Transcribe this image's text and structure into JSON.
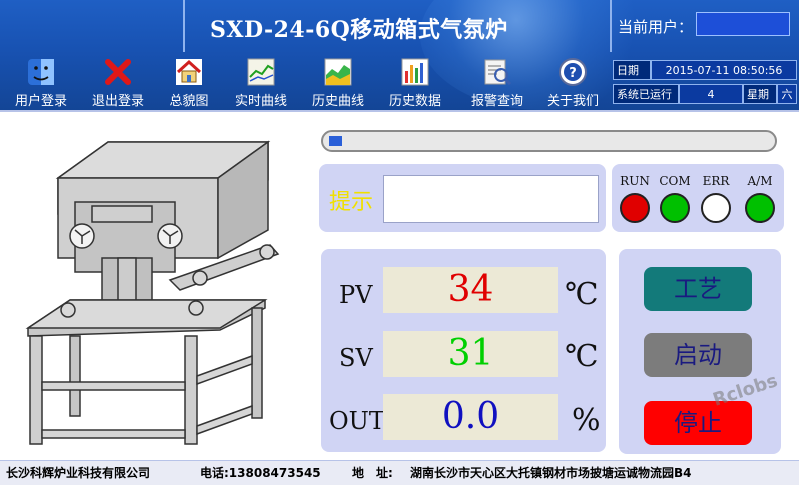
{
  "header": {
    "title": "SXD-24-6Q移动箱式气氛炉",
    "user_label": "当前用户：",
    "user_value": ""
  },
  "toolbar": [
    {
      "label": "用户登录",
      "icon": "mac-finder-icon"
    },
    {
      "label": "退出登录",
      "icon": "red-x-icon"
    },
    {
      "label": "总貌图",
      "icon": "home-icon"
    },
    {
      "label": "实时曲线",
      "icon": "realtime-chart-icon"
    },
    {
      "label": "历史曲线",
      "icon": "history-chart-icon"
    },
    {
      "label": "历史数据",
      "icon": "history-data-icon"
    },
    {
      "label": "报警查询",
      "icon": "alarm-search-icon"
    },
    {
      "label": "关于我们",
      "icon": "help-icon"
    }
  ],
  "info": {
    "date_label": "日期",
    "date_value": "2015-07-11 08:50:56",
    "runtime_label": "系统已运行",
    "runtime_value": "4",
    "week_label": "星期",
    "week_value": "六"
  },
  "progress": {
    "value": 0.03
  },
  "tip": {
    "label": "提示",
    "text": ""
  },
  "leds": [
    {
      "label": "RUN",
      "color": "#e00000"
    },
    {
      "label": "COM",
      "color": "#00c000"
    },
    {
      "label": "ERR",
      "color": "#ffffff"
    },
    {
      "label": "A/M",
      "color": "#00c000"
    }
  ],
  "readings": [
    {
      "label": "PV",
      "value": "34",
      "unit": "℃",
      "color": "#e00000"
    },
    {
      "label": "SV",
      "value": "31",
      "unit": "℃",
      "color": "#00d000"
    },
    {
      "label": "OUT",
      "value": "0.0",
      "unit": "%",
      "color": "#1010c0"
    }
  ],
  "buttons": {
    "process": {
      "label": "工艺",
      "bg": "#137a7a"
    },
    "start": {
      "label": "启动",
      "bg": "#7c7c7c"
    },
    "stop": {
      "label": "停止",
      "bg": "#ff0000"
    }
  },
  "footer": {
    "company": "长沙科辉炉业科技有限公司",
    "phone": "电话:13808473545",
    "address_label": "地　址:",
    "address": "湖南长沙市天心区大托镇钢材市场披塘运诚物流园B4"
  },
  "watermark": "Rclobs"
}
